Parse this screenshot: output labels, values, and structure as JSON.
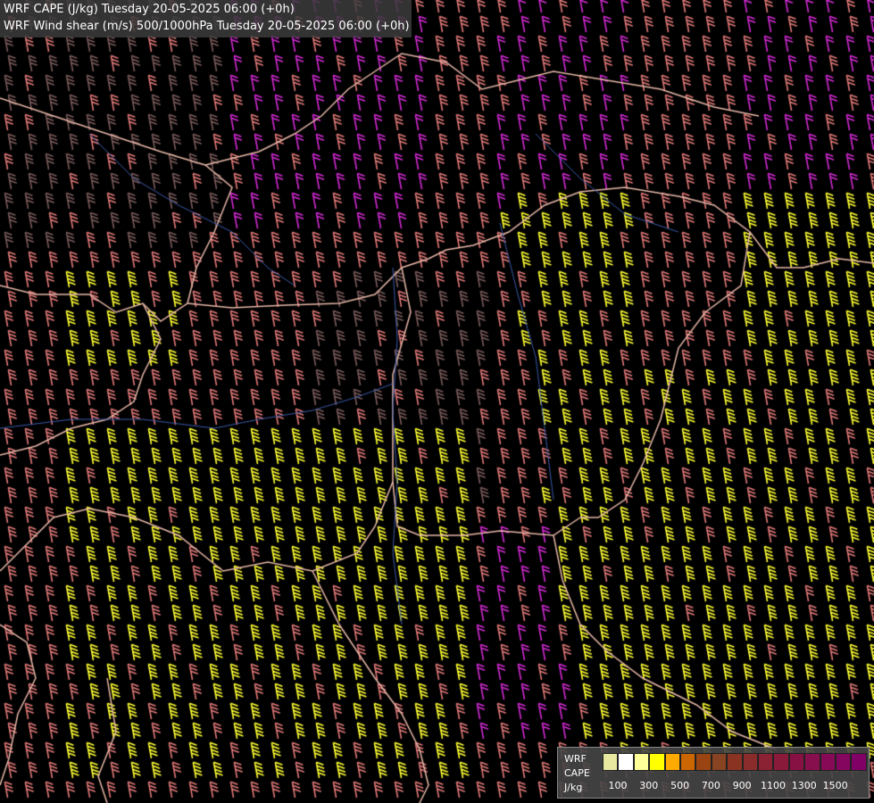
{
  "title": {
    "line1": "WRF CAPE (J/kg) Tuesday 20-05-2025 06:00 (+0h)",
    "line2": "WRF Wind shear (m/s) 500/1000hPa Tuesday 20-05-2025 06:00 (+0h)"
  },
  "legend": {
    "label_model": "WRF",
    "label_field": "CAPE",
    "label_unit": "J/kg",
    "colors": [
      "#e8e8a0",
      "#ffffff",
      "#ffff99",
      "#ffff00",
      "#ffaa00",
      "#cc6600",
      "#994411",
      "#884422",
      "#8a3322",
      "#8a2c2c",
      "#8a2233",
      "#8a1a3a",
      "#881144",
      "#880f4d",
      "#860a55",
      "#84065e",
      "#800066"
    ],
    "ticks": [
      "100",
      "300",
      "500",
      "700",
      "900",
      "1100",
      "1300",
      "1500"
    ]
  },
  "map": {
    "barb_colors": {
      "dark": "#7a5a5a",
      "salmon": "#e07878",
      "magenta": "#d22ad2",
      "yellow": "#ffff33"
    },
    "border_color": "#e8b8a8",
    "river_color": "#3a5aa8"
  }
}
